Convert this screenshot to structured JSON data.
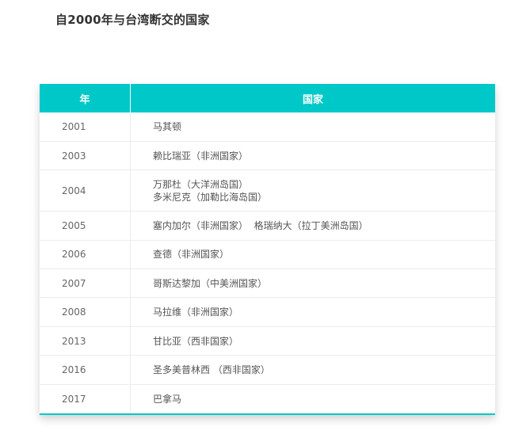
{
  "page": {
    "title": "自2000年与台湾断交的国家"
  },
  "table": {
    "headers": {
      "year": "年",
      "country": "国家"
    },
    "rows": [
      {
        "year": "2001",
        "lines": [
          "马其顿"
        ]
      },
      {
        "year": "2003",
        "lines": [
          "赖比瑞亚（非洲国家）"
        ]
      },
      {
        "year": "2004",
        "lines": [
          "万那杜（大洋洲岛国）",
          "多米尼克（加勒比海岛国）"
        ]
      },
      {
        "year": "2005",
        "lines": [
          "塞内加尔（非洲国家）  格瑞纳大（拉丁美洲岛国）"
        ]
      },
      {
        "year": "2006",
        "lines": [
          "查德（非洲国家）"
        ]
      },
      {
        "year": "2007",
        "lines": [
          "哥斯达黎加（中美洲国家）"
        ]
      },
      {
        "year": "2008",
        "lines": [
          "马拉维（非洲国家）"
        ]
      },
      {
        "year": "2013",
        "lines": [
          "甘比亚（西非国家）"
        ]
      },
      {
        "year": "2016",
        "lines": [
          "圣多美普林西 （西非国家）"
        ]
      },
      {
        "year": "2017",
        "lines": [
          "巴拿马"
        ]
      }
    ]
  },
  "colors": {
    "header_background": "#00c8c8",
    "header_text": "#ffffff",
    "title_text": "#333333",
    "cell_text": "#555555"
  }
}
